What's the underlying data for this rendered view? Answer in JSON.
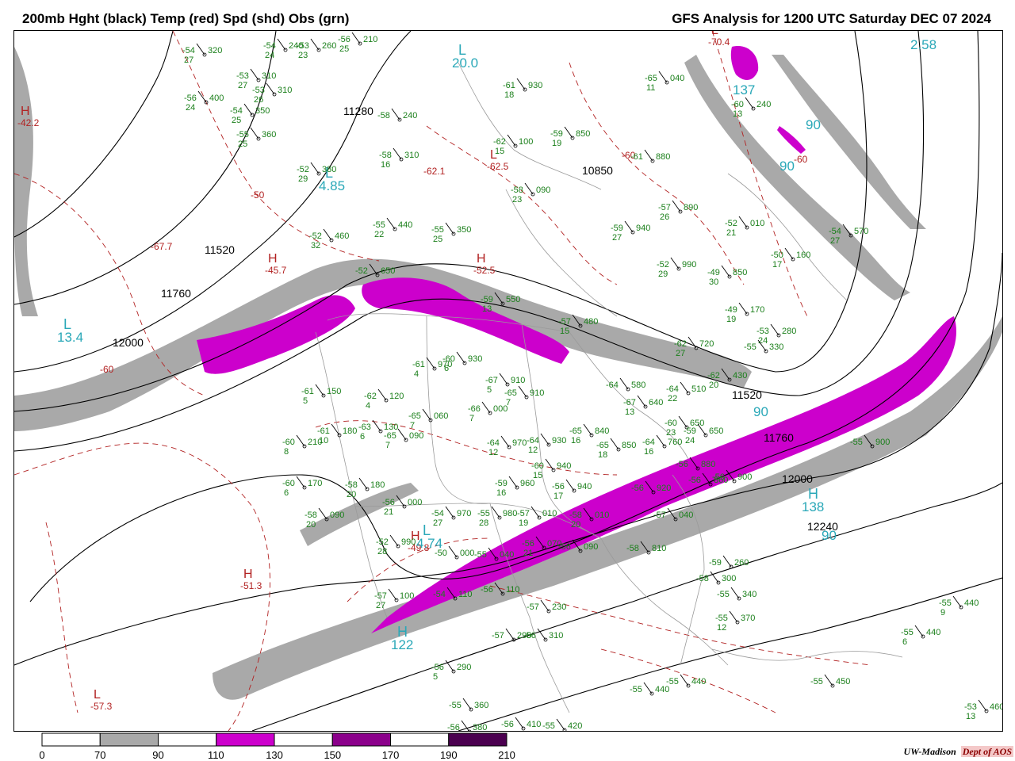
{
  "header": {
    "left_title": "200mb Hght (black) Temp (red) Spd (shd) Obs (grn)",
    "right_title": "GFS Analysis for 1200 UTC Saturday  DEC 07 2024"
  },
  "colors": {
    "height_contour": "#000000",
    "temperature": "#b22222",
    "observations": "#1a7f1a",
    "speed_label": "#2aa8b8",
    "border_lines": "#9a9a9a",
    "shade_70_90": "#a9a9a9",
    "shade_110_130": "#cc00cc",
    "shade_150_170": "#8b008b",
    "shade_190_210": "#4b0050"
  },
  "colorbar": {
    "ticks": [
      "0",
      "70",
      "90",
      "110",
      "130",
      "150",
      "170",
      "190",
      "210"
    ],
    "fills": [
      "#ffffff",
      "#a9a9a9",
      "#ffffff",
      "#cc00cc",
      "#ffffff",
      "#8b008b",
      "#ffffff",
      "#4b0050"
    ]
  },
  "height_labels": [
    "11280",
    "10850",
    "11520",
    "11760",
    "12000",
    "11520",
    "11760",
    "12000",
    "12240"
  ],
  "temp_centers": [
    {
      "mark": "H",
      "value": "-42.2"
    },
    {
      "mark": "H",
      "value": "-45.7"
    },
    {
      "mark": "H",
      "value": "-52.5"
    },
    {
      "mark": "H",
      "value": "-51.3"
    },
    {
      "mark": "H",
      "value": "-49.8"
    },
    {
      "mark": "L",
      "value": "-57.3"
    },
    {
      "mark": "L",
      "value": "-62.5"
    },
    {
      "mark": "L",
      "value": "-70.4"
    },
    {
      "mark": "",
      "value": "-67.7"
    },
    {
      "mark": "",
      "value": "-60"
    },
    {
      "mark": "",
      "value": "-50"
    },
    {
      "mark": "",
      "value": "-60"
    },
    {
      "mark": "",
      "value": "-60"
    },
    {
      "mark": "",
      "value": "-62.1"
    }
  ],
  "speed_centers": [
    {
      "mark": "L",
      "value": "20.0"
    },
    {
      "mark": "L",
      "value": "13.4"
    },
    {
      "mark": "L",
      "value": "4.74"
    },
    {
      "mark": "L",
      "value": "4.85"
    },
    {
      "mark": "H",
      "value": "122"
    },
    {
      "mark": "H",
      "value": "138"
    },
    {
      "mark": "",
      "value": "2.58"
    },
    {
      "mark": "",
      "value": "90"
    },
    {
      "mark": "",
      "value": "90"
    },
    {
      "mark": "",
      "value": "90"
    },
    {
      "mark": "",
      "value": "90"
    },
    {
      "mark": "",
      "value": "137"
    }
  ],
  "observations": [
    {
      "t": "-54",
      "h": "320",
      "s": "27"
    },
    {
      "t": "-54",
      "h": "240",
      "s": "24"
    },
    {
      "t": "-53",
      "h": "260",
      "s": "23"
    },
    {
      "t": "-56",
      "h": "210",
      "s": "25"
    },
    {
      "t": "-53",
      "h": "310",
      "s": "27"
    },
    {
      "t": "-56",
      "h": "400",
      "s": "24"
    },
    {
      "t": "-53",
      "h": "310",
      "s": "26"
    },
    {
      "t": "-54",
      "h": "350",
      "s": "25"
    },
    {
      "t": "-55",
      "h": "360",
      "s": "25"
    },
    {
      "t": "-52",
      "h": "380",
      "s": "29"
    },
    {
      "t": "-52",
      "h": "460",
      "s": "32"
    },
    {
      "t": "-55",
      "h": "440",
      "s": "22"
    },
    {
      "t": "-55",
      "h": "350",
      "s": "25"
    },
    {
      "t": "-58",
      "h": "240",
      "s": ""
    },
    {
      "t": "-58",
      "h": "310",
      "s": "16"
    },
    {
      "t": "-62",
      "h": "100",
      "s": "15"
    },
    {
      "t": "-58",
      "h": "090",
      "s": "23"
    },
    {
      "t": "-61",
      "h": "930",
      "s": "18"
    },
    {
      "t": "-59",
      "h": "850",
      "s": "19"
    },
    {
      "t": "-61",
      "h": "880",
      "s": ""
    },
    {
      "t": "-57",
      "h": "890",
      "s": "26"
    },
    {
      "t": "-65",
      "h": "040",
      "s": "11"
    },
    {
      "t": "-60",
      "h": "240",
      "s": "13"
    },
    {
      "t": "-52",
      "h": "010",
      "s": "21"
    },
    {
      "t": "-54",
      "h": "570",
      "s": "27"
    },
    {
      "t": "-50",
      "h": "160",
      "s": "17"
    },
    {
      "t": "-49",
      "h": "850",
      "s": "30"
    },
    {
      "t": "-52",
      "h": "990",
      "s": "29"
    },
    {
      "t": "-59",
      "h": "940",
      "s": "27"
    },
    {
      "t": "-52",
      "h": "650",
      "s": ""
    },
    {
      "t": "-49",
      "h": "170",
      "s": "19"
    },
    {
      "t": "-53",
      "h": "280",
      "s": "24"
    },
    {
      "t": "-59",
      "h": "550",
      "s": "13"
    },
    {
      "t": "-57",
      "h": "480",
      "s": "15"
    },
    {
      "t": "-62",
      "h": "720",
      "s": "27"
    },
    {
      "t": "-55",
      "h": "330",
      "s": ""
    },
    {
      "t": "-62",
      "h": "430",
      "s": "20"
    },
    {
      "t": "-61",
      "h": "970",
      "s": "4"
    },
    {
      "t": "-60",
      "h": "930",
      "s": "6"
    },
    {
      "t": "-67",
      "h": "910",
      "s": "5"
    },
    {
      "t": "-65",
      "h": "910",
      "s": "7"
    },
    {
      "t": "-64",
      "h": "580",
      "s": ""
    },
    {
      "t": "-64",
      "h": "510",
      "s": "22"
    },
    {
      "t": "-67",
      "h": "640",
      "s": "13"
    },
    {
      "t": "-60",
      "h": "650",
      "s": "23"
    },
    {
      "t": "-59",
      "h": "650",
      "s": "24"
    },
    {
      "t": "-61",
      "h": "150",
      "s": "5"
    },
    {
      "t": "-62",
      "h": "120",
      "s": "4"
    },
    {
      "t": "-65",
      "h": "060",
      "s": "7"
    },
    {
      "t": "-66",
      "h": "000",
      "s": "7"
    },
    {
      "t": "-61",
      "h": "180",
      "s": "10"
    },
    {
      "t": "-63",
      "h": "130",
      "s": "6"
    },
    {
      "t": "-65",
      "h": "090",
      "s": "7"
    },
    {
      "t": "-60",
      "h": "210",
      "s": "8"
    },
    {
      "t": "-64",
      "h": "970",
      "s": "12"
    },
    {
      "t": "-64",
      "h": "930",
      "s": "12"
    },
    {
      "t": "-65",
      "h": "840",
      "s": "16"
    },
    {
      "t": "-65",
      "h": "850",
      "s": "18"
    },
    {
      "t": "-64",
      "h": "760",
      "s": "16"
    },
    {
      "t": "-60",
      "h": "940",
      "s": "15"
    },
    {
      "t": "-60",
      "h": "170",
      "s": "6"
    },
    {
      "t": "-58",
      "h": "180",
      "s": "20"
    },
    {
      "t": "-59",
      "h": "960",
      "s": "16"
    },
    {
      "t": "-56",
      "h": "940",
      "s": "17"
    },
    {
      "t": "-56",
      "h": "920",
      "s": ""
    },
    {
      "t": "-58",
      "h": "090",
      "s": "20"
    },
    {
      "t": "-56",
      "h": "000",
      "s": "21"
    },
    {
      "t": "-54",
      "h": "970",
      "s": "27"
    },
    {
      "t": "-55",
      "h": "980",
      "s": "28"
    },
    {
      "t": "-57",
      "h": "010",
      "s": "19"
    },
    {
      "t": "-58",
      "h": "010",
      "s": "20"
    },
    {
      "t": "-57",
      "h": "040",
      "s": ""
    },
    {
      "t": "-52",
      "h": "990",
      "s": "28"
    },
    {
      "t": "-50",
      "h": "000",
      "s": ""
    },
    {
      "t": "-55",
      "h": "040",
      "s": ""
    },
    {
      "t": "-56",
      "h": "070",
      "s": "21"
    },
    {
      "t": "-56",
      "h": "090",
      "s": ""
    },
    {
      "t": "-58",
      "h": "810",
      "s": ""
    },
    {
      "t": "-56",
      "h": "880",
      "s": ""
    },
    {
      "t": "-56",
      "h": "860",
      "s": ""
    },
    {
      "t": "-56",
      "h": "900",
      "s": ""
    },
    {
      "t": "-59",
      "h": "260",
      "s": ""
    },
    {
      "t": "-58",
      "h": "300",
      "s": ""
    },
    {
      "t": "-55",
      "h": "340",
      "s": ""
    },
    {
      "t": "-55",
      "h": "370",
      "s": "12"
    },
    {
      "t": "-57",
      "h": "100",
      "s": "27"
    },
    {
      "t": "-54",
      "h": "110",
      "s": ""
    },
    {
      "t": "-56",
      "h": "110",
      "s": ""
    },
    {
      "t": "-57",
      "h": "230",
      "s": ""
    },
    {
      "t": "-57",
      "h": "290",
      "s": ""
    },
    {
      "t": "-56",
      "h": "310",
      "s": ""
    },
    {
      "t": "-56",
      "h": "290",
      "s": "5"
    },
    {
      "t": "-55",
      "h": "360",
      "s": ""
    },
    {
      "t": "-56",
      "h": "380",
      "s": ""
    },
    {
      "t": "-56",
      "h": "410",
      "s": ""
    },
    {
      "t": "-55",
      "h": "420",
      "s": ""
    },
    {
      "t": "-55",
      "h": "440",
      "s": ""
    },
    {
      "t": "-55",
      "h": "450",
      "s": ""
    },
    {
      "t": "-55",
      "h": "440",
      "s": ""
    },
    {
      "t": "-55",
      "h": "440",
      "s": "6"
    },
    {
      "t": "-55",
      "h": "440",
      "s": "9"
    },
    {
      "t": "-53",
      "h": "460",
      "s": "13"
    },
    {
      "t": "-55",
      "h": "900",
      "s": ""
    }
  ],
  "credit": {
    "org": "UW-Madison",
    "dept": "Dept of AOS"
  }
}
